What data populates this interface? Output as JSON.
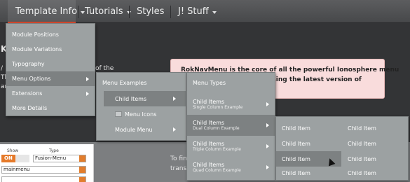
{
  "nav": {
    "items": [
      {
        "label": "Template Info"
      },
      {
        "label": "Tutorials"
      },
      {
        "label": "Styles"
      },
      {
        "label": "J! Stuff"
      }
    ]
  },
  "menu1": {
    "items": [
      {
        "label": "Module Positions"
      },
      {
        "label": "Module Variations"
      },
      {
        "label": "Typography"
      },
      {
        "label": "Menu Options"
      },
      {
        "label": "Extensions"
      },
      {
        "label": "More Details"
      }
    ]
  },
  "menu2": {
    "header": "Menu Examples",
    "items": [
      {
        "label": "Child Items"
      },
      {
        "label": "Menu Icons"
      },
      {
        "label": "Module Menu"
      }
    ]
  },
  "menu3": {
    "header": "Menu Types",
    "items": [
      {
        "title": "Child Items",
        "subtitle": "Single Column Example"
      },
      {
        "title": "Child Items",
        "subtitle": "Dual Column Example"
      },
      {
        "title": "Child Items",
        "subtitle": "Triple Column Example"
      },
      {
        "title": "Child Items",
        "subtitle": "Quad Column Example"
      }
    ]
  },
  "menu4": {
    "col1": [
      "Child Item",
      "Child Item",
      "Child Item",
      "Child Item"
    ],
    "col2": [
      "Child Item",
      "Child Item",
      "Child Item",
      "Child Item"
    ]
  },
  "background": {
    "left_k": "K",
    "left_lines": [
      "/",
      "Th",
      "ar"
    ],
    "of_the": "of the",
    "pink_line1": "RokNavMenu is the core of all the powerful Ionosphere menu",
    "pink_line2": "using the latest version of",
    "to_fin": "To fin",
    "transi": "transi"
  },
  "admin_form": {
    "show_label": "Show",
    "type_label": "Type",
    "toggle_on": "ON",
    "type_value": "Fusion-Menu",
    "menu_value": "mainmenu"
  },
  "colors": {
    "accent": "#d8492e",
    "menu_bg": "#9ca1a2",
    "menu_hover": "#7d8182",
    "toggle_on": "#e57a2a"
  }
}
